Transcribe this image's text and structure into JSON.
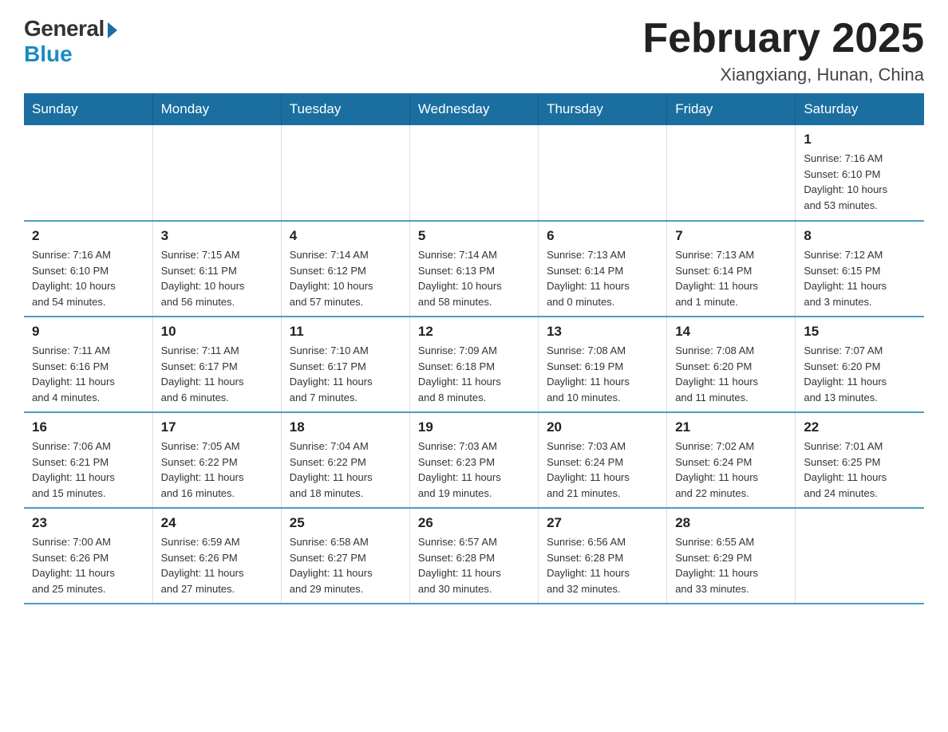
{
  "header": {
    "logo_general": "General",
    "logo_blue": "Blue",
    "month_title": "February 2025",
    "location": "Xiangxiang, Hunan, China"
  },
  "days_of_week": [
    "Sunday",
    "Monday",
    "Tuesday",
    "Wednesday",
    "Thursday",
    "Friday",
    "Saturday"
  ],
  "weeks": [
    [
      {
        "num": "",
        "info": ""
      },
      {
        "num": "",
        "info": ""
      },
      {
        "num": "",
        "info": ""
      },
      {
        "num": "",
        "info": ""
      },
      {
        "num": "",
        "info": ""
      },
      {
        "num": "",
        "info": ""
      },
      {
        "num": "1",
        "info": "Sunrise: 7:16 AM\nSunset: 6:10 PM\nDaylight: 10 hours\nand 53 minutes."
      }
    ],
    [
      {
        "num": "2",
        "info": "Sunrise: 7:16 AM\nSunset: 6:10 PM\nDaylight: 10 hours\nand 54 minutes."
      },
      {
        "num": "3",
        "info": "Sunrise: 7:15 AM\nSunset: 6:11 PM\nDaylight: 10 hours\nand 56 minutes."
      },
      {
        "num": "4",
        "info": "Sunrise: 7:14 AM\nSunset: 6:12 PM\nDaylight: 10 hours\nand 57 minutes."
      },
      {
        "num": "5",
        "info": "Sunrise: 7:14 AM\nSunset: 6:13 PM\nDaylight: 10 hours\nand 58 minutes."
      },
      {
        "num": "6",
        "info": "Sunrise: 7:13 AM\nSunset: 6:14 PM\nDaylight: 11 hours\nand 0 minutes."
      },
      {
        "num": "7",
        "info": "Sunrise: 7:13 AM\nSunset: 6:14 PM\nDaylight: 11 hours\nand 1 minute."
      },
      {
        "num": "8",
        "info": "Sunrise: 7:12 AM\nSunset: 6:15 PM\nDaylight: 11 hours\nand 3 minutes."
      }
    ],
    [
      {
        "num": "9",
        "info": "Sunrise: 7:11 AM\nSunset: 6:16 PM\nDaylight: 11 hours\nand 4 minutes."
      },
      {
        "num": "10",
        "info": "Sunrise: 7:11 AM\nSunset: 6:17 PM\nDaylight: 11 hours\nand 6 minutes."
      },
      {
        "num": "11",
        "info": "Sunrise: 7:10 AM\nSunset: 6:17 PM\nDaylight: 11 hours\nand 7 minutes."
      },
      {
        "num": "12",
        "info": "Sunrise: 7:09 AM\nSunset: 6:18 PM\nDaylight: 11 hours\nand 8 minutes."
      },
      {
        "num": "13",
        "info": "Sunrise: 7:08 AM\nSunset: 6:19 PM\nDaylight: 11 hours\nand 10 minutes."
      },
      {
        "num": "14",
        "info": "Sunrise: 7:08 AM\nSunset: 6:20 PM\nDaylight: 11 hours\nand 11 minutes."
      },
      {
        "num": "15",
        "info": "Sunrise: 7:07 AM\nSunset: 6:20 PM\nDaylight: 11 hours\nand 13 minutes."
      }
    ],
    [
      {
        "num": "16",
        "info": "Sunrise: 7:06 AM\nSunset: 6:21 PM\nDaylight: 11 hours\nand 15 minutes."
      },
      {
        "num": "17",
        "info": "Sunrise: 7:05 AM\nSunset: 6:22 PM\nDaylight: 11 hours\nand 16 minutes."
      },
      {
        "num": "18",
        "info": "Sunrise: 7:04 AM\nSunset: 6:22 PM\nDaylight: 11 hours\nand 18 minutes."
      },
      {
        "num": "19",
        "info": "Sunrise: 7:03 AM\nSunset: 6:23 PM\nDaylight: 11 hours\nand 19 minutes."
      },
      {
        "num": "20",
        "info": "Sunrise: 7:03 AM\nSunset: 6:24 PM\nDaylight: 11 hours\nand 21 minutes."
      },
      {
        "num": "21",
        "info": "Sunrise: 7:02 AM\nSunset: 6:24 PM\nDaylight: 11 hours\nand 22 minutes."
      },
      {
        "num": "22",
        "info": "Sunrise: 7:01 AM\nSunset: 6:25 PM\nDaylight: 11 hours\nand 24 minutes."
      }
    ],
    [
      {
        "num": "23",
        "info": "Sunrise: 7:00 AM\nSunset: 6:26 PM\nDaylight: 11 hours\nand 25 minutes."
      },
      {
        "num": "24",
        "info": "Sunrise: 6:59 AM\nSunset: 6:26 PM\nDaylight: 11 hours\nand 27 minutes."
      },
      {
        "num": "25",
        "info": "Sunrise: 6:58 AM\nSunset: 6:27 PM\nDaylight: 11 hours\nand 29 minutes."
      },
      {
        "num": "26",
        "info": "Sunrise: 6:57 AM\nSunset: 6:28 PM\nDaylight: 11 hours\nand 30 minutes."
      },
      {
        "num": "27",
        "info": "Sunrise: 6:56 AM\nSunset: 6:28 PM\nDaylight: 11 hours\nand 32 minutes."
      },
      {
        "num": "28",
        "info": "Sunrise: 6:55 AM\nSunset: 6:29 PM\nDaylight: 11 hours\nand 33 minutes."
      },
      {
        "num": "",
        "info": ""
      }
    ]
  ]
}
